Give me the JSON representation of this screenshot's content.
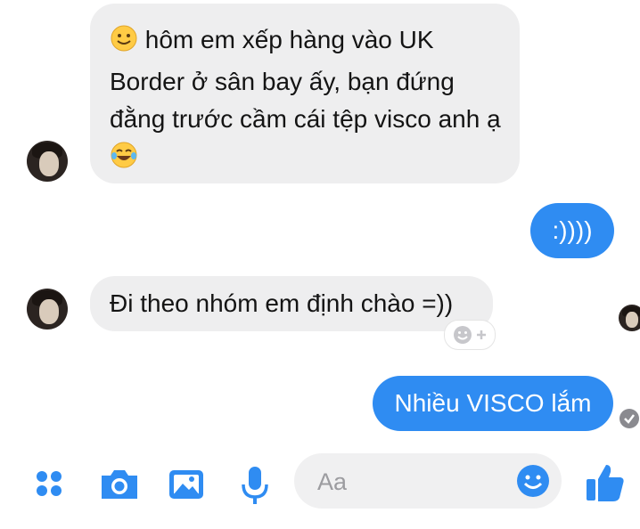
{
  "conversation": {
    "messages": [
      {
        "direction": "incoming",
        "text": "hôm em xếp hàng vào UK Border ở sân bay ấy, bạn đứng đằng trước cầm cái tệp visco anh ạ",
        "leading_emoji": "slightly-smiling-face",
        "trailing_emoji": "face-with-tears-of-joy"
      },
      {
        "direction": "outgoing",
        "text": ":))))"
      },
      {
        "direction": "incoming",
        "text": "Đi theo nhóm em định chào =))"
      },
      {
        "direction": "outgoing",
        "text": "Nhiều VISCO lắm",
        "status": "delivered-check"
      }
    ]
  },
  "composer": {
    "placeholder": "Aa"
  },
  "toolbar": {
    "icons": [
      "more-apps-icon",
      "camera-icon",
      "gallery-icon",
      "microphone-icon",
      "emoji-icon",
      "like-thumb-icon"
    ]
  },
  "colors": {
    "accent": "#2f8cf2",
    "incoming_bubble": "#eeeeef",
    "background": "#ffffff"
  }
}
